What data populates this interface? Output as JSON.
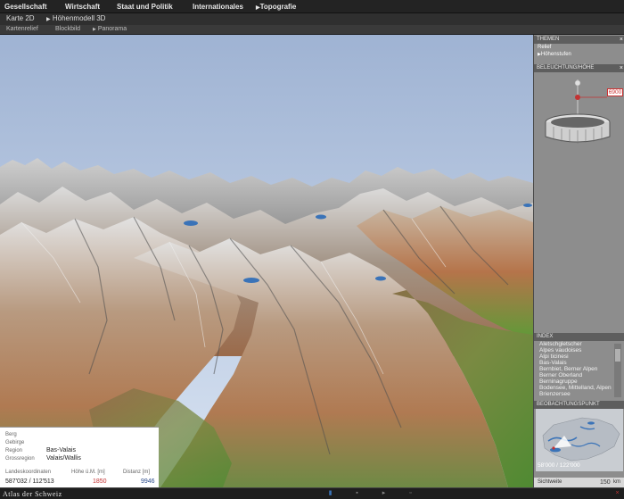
{
  "top_nav": {
    "items": [
      "Gesellschaft",
      "Wirtschaft",
      "Staat und Politik",
      "Internationales",
      "Topografie"
    ],
    "current_arrow_icon": "triangle-right-icon"
  },
  "sub_nav": {
    "items": [
      "Karte 2D",
      "Höhenmodell 3D"
    ],
    "arrow_icon": "triangle-right-icon"
  },
  "mode_nav": {
    "items": [
      "Kartenrelief",
      "Blockbild",
      "Panorama"
    ],
    "active": "Panorama"
  },
  "info_panel": {
    "labels": {
      "berg": "Berg",
      "gebirge": "Gebirge",
      "region": "Region",
      "grossregion": "Grossregion",
      "coords": "Landeskoordinaten",
      "height": "Höhe ü.M. [m]",
      "distance": "Distanz [m]"
    },
    "values": {
      "region": "Bas-Valais",
      "grossregion": "Valais/Wallis",
      "coords": "587'032 / 112'513",
      "height": "1850",
      "distance": "9946"
    }
  },
  "sidebar": {
    "themen": {
      "title": "THEMEN",
      "items": [
        "Relief",
        "Höhenstufen"
      ],
      "active": "Höhenstufen"
    },
    "beleuchtung": {
      "title": "BELEUCHTUNG/HÖHE",
      "height_value": "6900"
    },
    "index": {
      "title": "INDEX",
      "items": [
        "Aletschgletscher",
        "Alpes vaudoises",
        "Alpi ticinesi",
        "Bas-Valais",
        "Bernbiet, Berner Alpen",
        "Berner Oberland",
        "Berninagruppe",
        "Bodensee, Mittelland, Alpen",
        "Brienzersee"
      ]
    },
    "beobachtung": {
      "title": "BEOBACHTUNGSPUNKT",
      "coords": "58'000 / 122'000"
    },
    "scale": {
      "label": "Sichtweite",
      "value": "150",
      "unit": "km"
    }
  },
  "status_bar": {
    "brand": "Atlas der Schweiz",
    "icons": [
      "info-icon",
      "print-icon",
      "help-icon",
      "zoom-icon",
      "close-icon"
    ]
  },
  "colors": {
    "sky_top": "#9fb3d3",
    "sky_bottom": "#d6e2f2",
    "sidebar_bg": "#8d8d8d",
    "accent_red": "#c33333",
    "lake_blue": "#3a73b8"
  }
}
